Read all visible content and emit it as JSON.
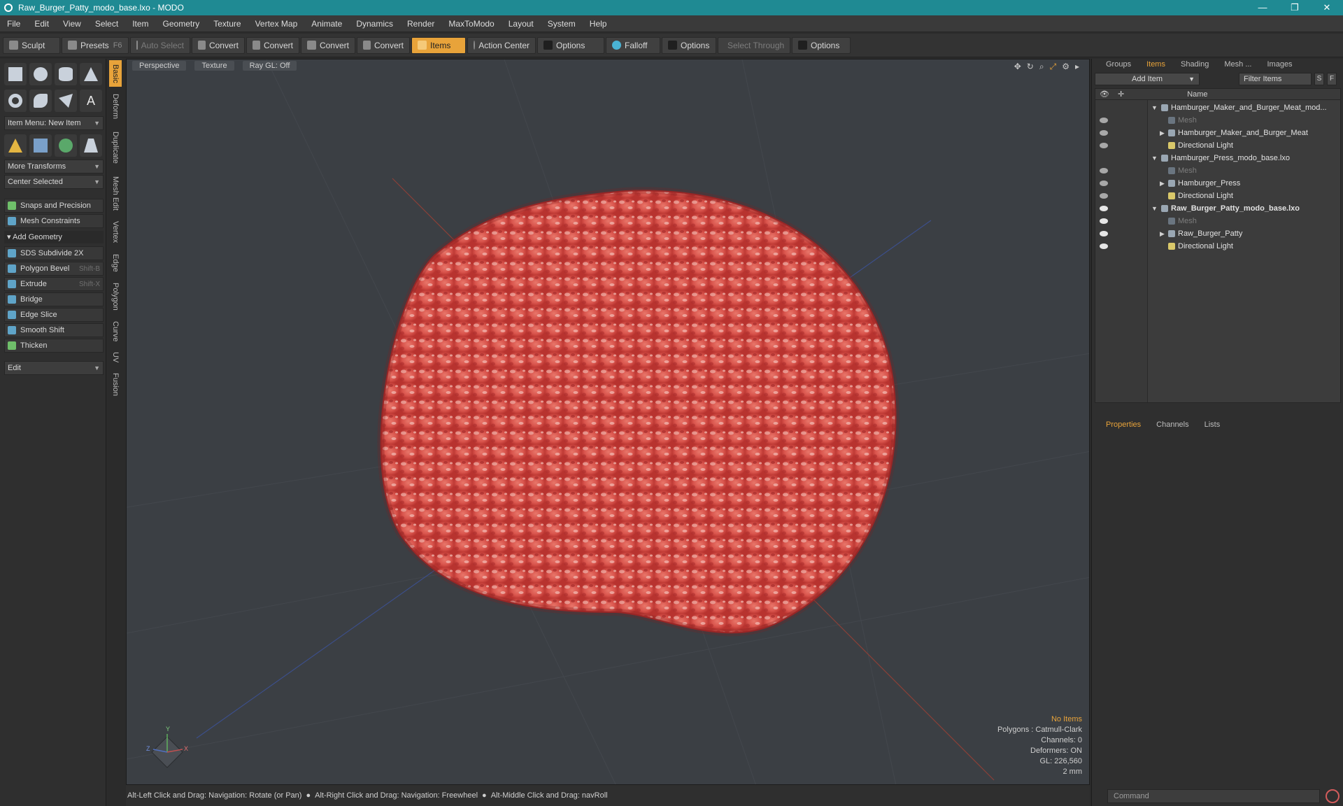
{
  "window": {
    "title": "Raw_Burger_Patty_modo_base.lxo - MODO",
    "controls": [
      "—",
      "❐",
      "✕"
    ]
  },
  "menu": [
    "File",
    "Edit",
    "View",
    "Select",
    "Item",
    "Geometry",
    "Texture",
    "Vertex Map",
    "Animate",
    "Dynamics",
    "Render",
    "MaxToModo",
    "Layout",
    "System",
    "Help"
  ],
  "toolbar": {
    "sculpt": "Sculpt",
    "presets": "Presets",
    "presets_key": "F6",
    "auto_select": "Auto Select",
    "convert": "Convert",
    "items": "Items",
    "action_center": "Action Center",
    "options": "Options",
    "falloff": "Falloff",
    "select_through": "Select Through"
  },
  "left": {
    "item_menu": "Item Menu: New Item",
    "more_transforms": "More Transforms",
    "center_selected": "Center Selected",
    "snaps": "Snaps and Precision",
    "constraints": "Mesh Constraints",
    "add_geometry": "Add Geometry",
    "tools": [
      {
        "label": "SDS Subdivide 2X",
        "key": ""
      },
      {
        "label": "Polygon Bevel",
        "key": "Shift-B"
      },
      {
        "label": "Extrude",
        "key": "Shift-X"
      },
      {
        "label": "Bridge",
        "key": ""
      },
      {
        "label": "Edge Slice",
        "key": ""
      },
      {
        "label": "Smooth Shift",
        "key": ""
      },
      {
        "label": "Thicken",
        "key": ""
      }
    ],
    "edit": "Edit",
    "vtabs": [
      "Basic",
      "Deform",
      "Duplicate",
      "Mesh Edit",
      "Vertex",
      "Edge",
      "Polygon",
      "Curve",
      "UV",
      "Fusion"
    ]
  },
  "viewport": {
    "tabs": [
      "Perspective",
      "Texture",
      "Ray GL: Off"
    ],
    "info": {
      "no_items": "No Items",
      "polygons": "Polygons : Catmull-Clark",
      "channels": "Channels: 0",
      "deformers": "Deformers: ON",
      "gl": "GL: 226,560",
      "scale": "2 mm"
    },
    "axes": {
      "x": "X",
      "y": "Y",
      "z": "Z"
    }
  },
  "status": {
    "a": "Alt-Left Click and Drag: Navigation: Rotate (or Pan)",
    "b": "Alt-Right Click and Drag: Navigation: Freewheel",
    "c": "Alt-Middle Click and Drag: navRoll"
  },
  "right": {
    "tabs": [
      "Groups",
      "Items",
      "Shading",
      "Mesh ...",
      "Images"
    ],
    "add_item": "Add Item",
    "filter": "Filter Items",
    "s": "S",
    "f": "F",
    "name_header": "Name",
    "tree": [
      {
        "label": "Hamburger_Maker_and_Burger_Meat_mod...",
        "style": "scene"
      },
      {
        "label": "Mesh",
        "style": "dim"
      },
      {
        "label": "Hamburger_Maker_and_Burger_Meat",
        "style": "child"
      },
      {
        "label": "Directional Light",
        "style": "child"
      },
      {
        "label": "Hamburger_Press_modo_base.lxo",
        "style": "scene"
      },
      {
        "label": "Mesh",
        "style": "dim"
      },
      {
        "label": "Hamburger_Press",
        "style": "child"
      },
      {
        "label": "Directional Light",
        "style": "child"
      },
      {
        "label": "Raw_Burger_Patty_modo_base.lxo",
        "style": "scene-bold"
      },
      {
        "label": "Mesh",
        "style": "dim"
      },
      {
        "label": "Raw_Burger_Patty",
        "style": "child"
      },
      {
        "label": "Directional Light",
        "style": "child"
      }
    ],
    "props_tabs": [
      "Properties",
      "Channels",
      "Lists"
    ],
    "command": "Command"
  },
  "colors": {
    "accent": "#e8a33a",
    "titlebar": "#1f8a93",
    "meat": "#d8544e"
  }
}
